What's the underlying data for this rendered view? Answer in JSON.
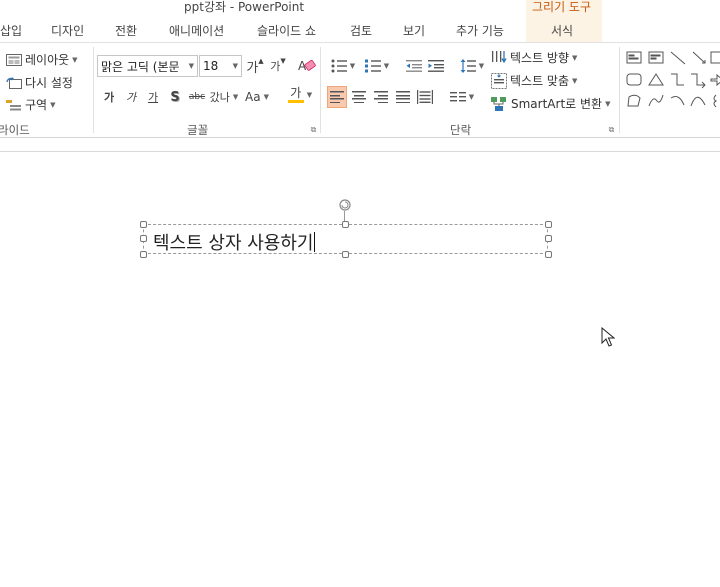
{
  "window": {
    "title": "ppt강좌 - PowerPoint",
    "context_group_label": "그리기 도구"
  },
  "tabs": [
    {
      "label": "삽입"
    },
    {
      "label": "디자인"
    },
    {
      "label": "전환"
    },
    {
      "label": "애니메이션"
    },
    {
      "label": "슬라이드 쇼"
    },
    {
      "label": "검토"
    },
    {
      "label": "보기"
    },
    {
      "label": "추가 기능"
    },
    {
      "label": "서식"
    }
  ],
  "ribbon": {
    "slides_group": {
      "label": "라이드",
      "layout_label": "레이아웃",
      "reset_label": "다시 설정",
      "section_label": "구역"
    },
    "font_group": {
      "label": "글꼴",
      "font_name": "맑은 고딕 (본문",
      "font_size": "18",
      "grow_label": "가",
      "shrink_label": "가",
      "bold_label": "가",
      "italic_label": "가",
      "underline_label": "가",
      "shadow_label": "S",
      "strike_label": "abc",
      "spacing_label": "갔나",
      "case_label": "Aa",
      "color_label": "가"
    },
    "paragraph_group": {
      "label": "단락",
      "text_direction_label": "텍스트 방향",
      "align_text_label": "텍스트 맞춤",
      "smartart_label": "SmartArt로 변환"
    }
  },
  "slide": {
    "textbox_text": "텍스트 상자 사용하기"
  },
  "colors": {
    "accent": "#c55a11",
    "context_bg": "#fdf3e4",
    "active_button": "#f7c9ae",
    "font_color_bar": "#ffc000"
  }
}
